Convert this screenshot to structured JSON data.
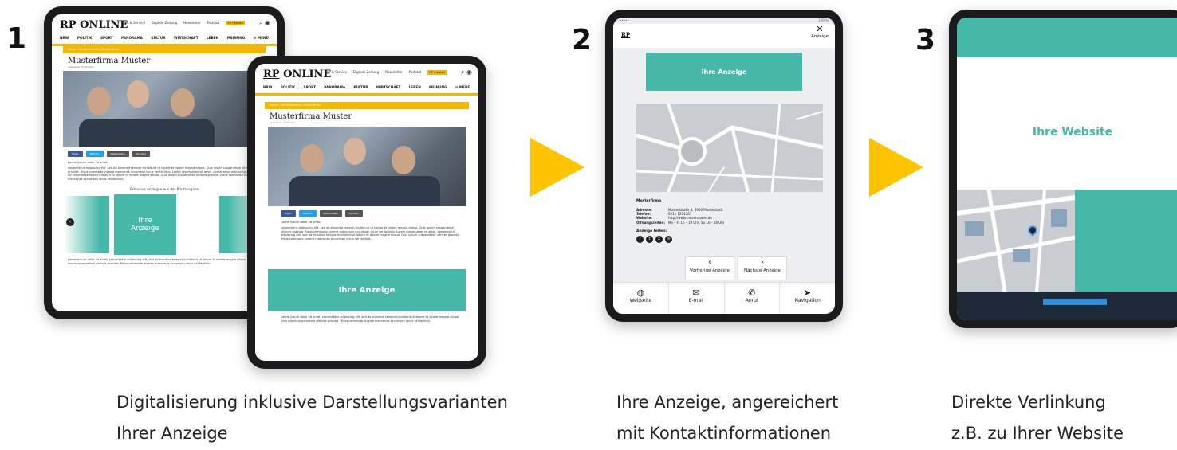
{
  "steps": [
    {
      "number": "1",
      "caption_line1": "Digitalisierung inklusive Darstellungsvarianten",
      "caption_line2": "Ihrer Anzeige"
    },
    {
      "number": "2",
      "caption_line1": "Ihre Anzeige, angereichert",
      "caption_line2": "mit Kontaktinformationen"
    },
    {
      "number": "3",
      "caption_line1": "Direkte Verlinkung",
      "caption_line2": "z.B. zu Ihrer Website"
    }
  ],
  "colors": {
    "accent_yellow": "#ffc400",
    "teal": "#45b8a9",
    "rp_yellow": "#f5b800",
    "tablet_frame": "#1b1b1d",
    "dark_navy": "#1e2a38"
  },
  "rp_site": {
    "logo_prefix": "RP",
    "logo_suffix": " ONLINE",
    "top_links": [
      "Abo & Service",
      "Digitale Zeitung",
      "Newsletter",
      "Podcast"
    ],
    "badge": "RP+ testen",
    "nav": [
      "NRW",
      "POLITIK",
      "SPORT",
      "PANORAMA",
      "KULTUR",
      "WIRTSCHAFT",
      "LEBEN",
      "MEINUNG",
      "☰ MENÜ"
    ],
    "breadcrumb": "Home / Sonderthemen / Musterfirma",
    "article_title": "Musterfirma Muster",
    "article_meta": "Lesedauer: 4 Minuten",
    "share": [
      "Teilen",
      "Twittern",
      "Weiterleiten",
      "Drucken"
    ],
    "lorem_intro": "Lorem ipsum dolor sit amet,",
    "lorem_body": "consectetur adipiscing elit, sed do eiusmod tempor incididunt ut labore et dolore magna aliqua. Quis ipsum suspendisse ultrices gravida. Risus commodo viverra maecenas accumsan lacus vel facilisis. Lorem ipsum dolor sit amet, consectetur adipiscing elit, sed do eiusmod tempor incididunt ut labore et dolore magna aliqua. Quis ipsum suspendisse ultrices gravida. Risus commodo viverra maecenas accumsan lacus vel facilisis.",
    "carousel_title": "Exklusive Anzeigen aus der Printausgabe",
    "ad_label_small": "Ihre\nAnzeige",
    "ad_label": "Ihre Anzeige",
    "lorem_footer": "Lorem ipsum dolor sit amet, consectetur adipiscing elit, sed do eiusmod tempor incididunt ut labore et dolore magna aliqua. Quis ipsum suspendisse ultrices gravida. Risus commodo viverra maecenas accumsan lacus vel facilisis."
  },
  "detail": {
    "status_left": "••••• ",
    "status_right": "100 %",
    "logo": "RP",
    "close_label": "Anzeige",
    "ad_label": "Ihre Anzeige",
    "company": "Musterfirma",
    "fields": [
      {
        "label": "Adresse:",
        "value": "Musterstraße 4, 4900 Musterstadt"
      },
      {
        "label": "Telefon:",
        "value": "0211 1234567"
      },
      {
        "label": "Website:",
        "value": "http://www.mustermann.de"
      },
      {
        "label": "Öffnungszeiten:",
        "value": "Mo – Fr 10 – 19 Uhr, Sa 10 – 16 Uhr"
      }
    ],
    "share_label": "Anzeige teilen:",
    "prev": "Vorherige Anzeige",
    "next": "Nächste Anzeige",
    "bottom": [
      {
        "icon": "globe-icon",
        "label": "Webseite"
      },
      {
        "icon": "mail-icon",
        "label": "E-mail"
      },
      {
        "icon": "phone-icon",
        "label": "Anruf"
      },
      {
        "icon": "navigation-icon",
        "label": "Navigation"
      }
    ]
  },
  "website": {
    "title": "Ihre Website"
  }
}
